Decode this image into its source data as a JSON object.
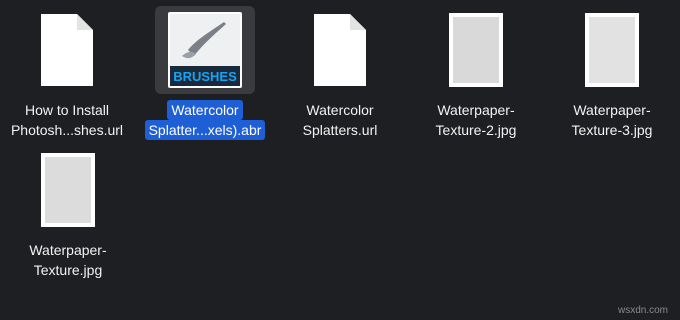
{
  "files": [
    {
      "name_line1": "How to Install",
      "name_line2": "Photosh...shes.url",
      "icon": "document-icon",
      "selected": false
    },
    {
      "name_line1": "Watercolor",
      "name_line2": "Splatter...xels).abr",
      "icon": "brush-file-icon",
      "thumb_text": "BRUSHES",
      "selected": true
    },
    {
      "name_line1": "Watercolor",
      "name_line2": "Splatters.url",
      "icon": "document-icon",
      "selected": false
    },
    {
      "name_line1": "Waterpaper-",
      "name_line2": "Texture-2.jpg",
      "icon": "image-thumbnail-icon",
      "selected": false
    },
    {
      "name_line1": "Waterpaper-",
      "name_line2": "Texture-3.jpg",
      "icon": "image-thumbnail-icon",
      "selected": false
    },
    {
      "name_line1": "Waterpaper-",
      "name_line2": "Texture.jpg",
      "icon": "image-thumbnail-icon",
      "selected": false
    }
  ],
  "watermark": "wsxdn.com",
  "colors": {
    "background": "#1e1f22",
    "selection": "#1f5fd6",
    "text": "#f2f2f2",
    "brushes_label": "#1aa2f0"
  }
}
